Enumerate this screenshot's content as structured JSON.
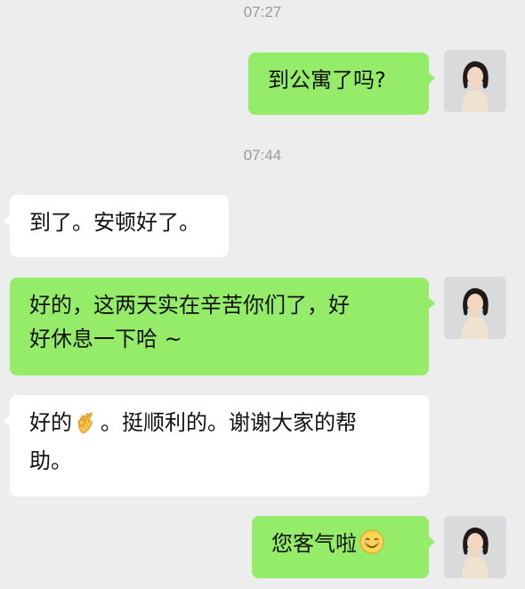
{
  "chat": {
    "messages": [
      {
        "type": "timestamp",
        "text": "07:27"
      },
      {
        "type": "message",
        "sender": "me",
        "text": "到公寓了吗?",
        "avatar_icon": "user-avatar-photo"
      },
      {
        "type": "timestamp",
        "text": "07:44"
      },
      {
        "type": "message",
        "sender": "other",
        "text": "到了。安顿好了。"
      },
      {
        "type": "message",
        "sender": "me",
        "text_line1": "好的，这两天实在辛苦你们了，好",
        "text_line2": "好休息一下哈 ~",
        "avatar_icon": "user-avatar-photo"
      },
      {
        "type": "message",
        "sender": "other",
        "text_before_emoji": "好的",
        "emoji": "ok-hand-emoji",
        "text_after_emoji": "。挺顺利的。谢谢大家的帮",
        "text_line2": "助。"
      },
      {
        "type": "message",
        "sender": "me",
        "text": "您客气啦",
        "emoji": "smiling-face-emoji",
        "avatar_icon": "user-avatar-photo"
      }
    ]
  },
  "colors": {
    "background": "#ededed",
    "outgoing_bubble": "#95ec69",
    "incoming_bubble": "#ffffff",
    "timestamp_text": "#9a9a9a"
  }
}
